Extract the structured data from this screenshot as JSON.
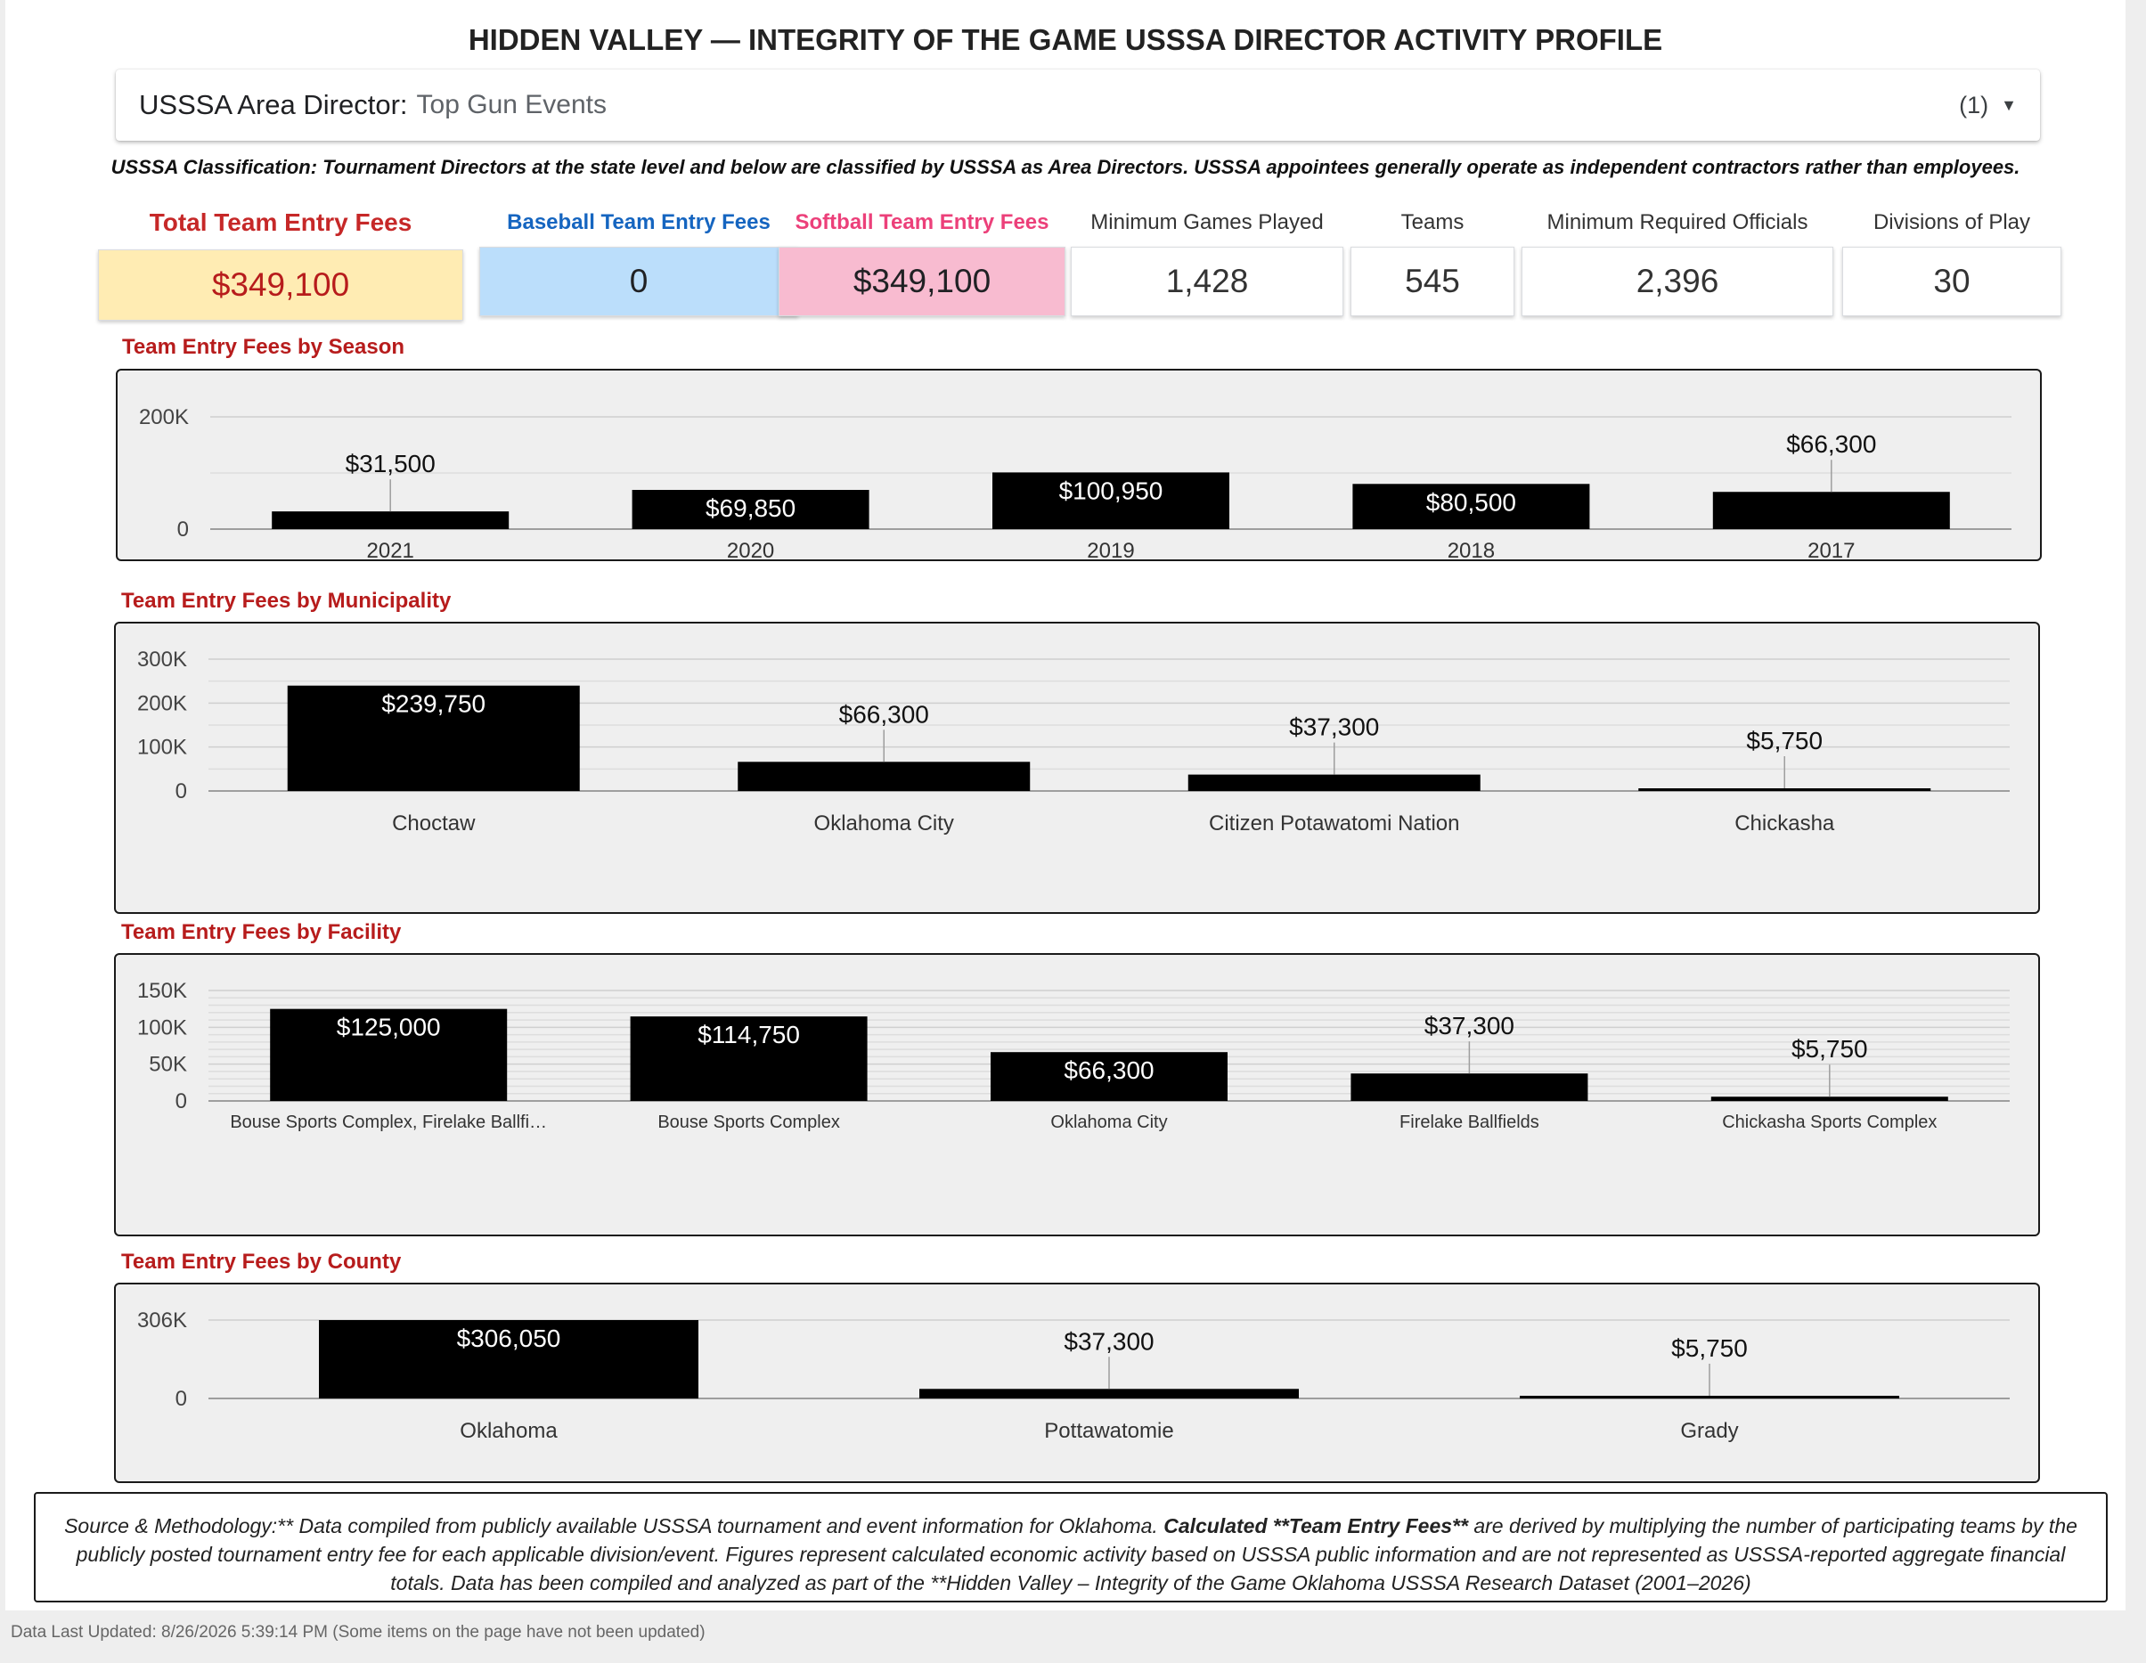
{
  "title": "HIDDEN VALLEY — INTEGRITY OF THE GAME USSSA DIRECTOR ACTIVITY PROFILE",
  "director_filter": {
    "label": "USSSA Area Director",
    "value": "Top Gun Events",
    "count": "(1)",
    "caret_icon": "caret-down-icon"
  },
  "classification": "USSSA Classification: Tournament Directors at the state level and below are classified by USSSA as Area Directors. USSSA appointees generally operate as independent contractors rather than employees.",
  "kpis": [
    {
      "label": "Total Team Entry Fees",
      "value": "$349,100",
      "label_color": "#c62828",
      "bg": "#ffecb3",
      "value_color": "#b71c1c"
    },
    {
      "label": "Baseball Team Entry Fees",
      "value": "0",
      "label_color": "#1565c0",
      "bg": "#bbdefb",
      "value_color": "#202124"
    },
    {
      "label": "Softball Team Entry Fees",
      "value": "$349,100",
      "label_color": "#ec407a",
      "bg": "#f8bbd0",
      "value_color": "#202124"
    },
    {
      "label": "Minimum Games Played",
      "value": "1,428",
      "label_color": "#333333",
      "bg": "#ffffff",
      "value_color": "#333333"
    },
    {
      "label": "Teams",
      "value": "545",
      "label_color": "#333333",
      "bg": "#ffffff",
      "value_color": "#333333"
    },
    {
      "label": "Minimum Required Officials",
      "value": "2,396",
      "label_color": "#333333",
      "bg": "#ffffff",
      "value_color": "#333333"
    },
    {
      "label": "Divisions of Play",
      "value": "30",
      "label_color": "#333333",
      "bg": "#ffffff",
      "value_color": "#333333"
    }
  ],
  "chart_data": [
    {
      "type": "bar",
      "title": "Team Entry Fees by Season",
      "categories": [
        "2021",
        "2020",
        "2019",
        "2018",
        "2017"
      ],
      "values": [
        31500,
        69850,
        100950,
        80500,
        66300
      ],
      "data_labels": [
        "$31,500",
        "$69,850",
        "$100,950",
        "$80,500",
        "$66,300"
      ],
      "ylim": [
        0,
        200000
      ],
      "y_ticks": [
        {
          "value": 200000,
          "label": "200K"
        },
        {
          "value": 0,
          "label": "0"
        }
      ],
      "grid": true,
      "bar_color": "#000000"
    },
    {
      "type": "bar",
      "title": "Team Entry Fees by Municipality",
      "categories": [
        "Choctaw",
        "Oklahoma City",
        "Citizen Potawatomi Nation",
        "Chickasha"
      ],
      "values": [
        239750,
        66300,
        37300,
        5750
      ],
      "data_labels": [
        "$239,750",
        "$66,300",
        "$37,300",
        "$5,750"
      ],
      "ylim": [
        0,
        300000
      ],
      "y_ticks": [
        {
          "value": 300000,
          "label": "300K"
        },
        {
          "value": 200000,
          "label": "200K"
        },
        {
          "value": 100000,
          "label": "100K"
        },
        {
          "value": 0,
          "label": "0"
        }
      ],
      "grid": true,
      "bar_color": "#000000"
    },
    {
      "type": "bar",
      "title": "Team Entry Fees by Facility",
      "categories": [
        "Bouse Sports Complex, Firelake Ballfi…",
        "Bouse Sports Complex",
        "Oklahoma City",
        "Firelake Ballfields",
        "Chickasha Sports Complex"
      ],
      "values": [
        125000,
        114750,
        66300,
        37300,
        5750
      ],
      "data_labels": [
        "$125,000",
        "$114,750",
        "$66,300",
        "$37,300",
        "$5,750"
      ],
      "ylim": [
        0,
        150000
      ],
      "y_ticks": [
        {
          "value": 150000,
          "label": "150K"
        },
        {
          "value": 100000,
          "label": "100K"
        },
        {
          "value": 50000,
          "label": "50K"
        },
        {
          "value": 0,
          "label": "0"
        }
      ],
      "grid": true,
      "bar_color": "#000000"
    },
    {
      "type": "bar",
      "title": "Team Entry Fees by County",
      "categories": [
        "Oklahoma",
        "Pottawatomie",
        "Grady"
      ],
      "values": [
        306050,
        37300,
        5750
      ],
      "data_labels": [
        "$306,050",
        "$37,300",
        "$5,750"
      ],
      "ylim": [
        0,
        306050
      ],
      "y_ticks": [
        {
          "value": 306050,
          "label": "306K"
        },
        {
          "value": 0,
          "label": "0"
        }
      ],
      "grid": true,
      "bar_color": "#000000"
    }
  ],
  "footer": {
    "part1": "Source & Methodology:** Data compiled from publicly available USSSA tournament and event information for Oklahoma. ",
    "bold": "Calculated **Team Entry Fees**",
    "part2": " are derived by multiplying the number of participating teams by the publicly posted tournament entry fee for each applicable division/event. Figures represent calculated economic activity based on USSSA public information and are not represented as USSSA-reported aggregate financial totals. Data has been compiled and analyzed as part of the **Hidden Valley – Integrity of the Game Oklahoma USSSA Research Dataset (2001–2026)"
  },
  "last_updated": "Data Last Updated: 8/26/2026 5:39:14 PM (Some items on the page have not been updated)"
}
